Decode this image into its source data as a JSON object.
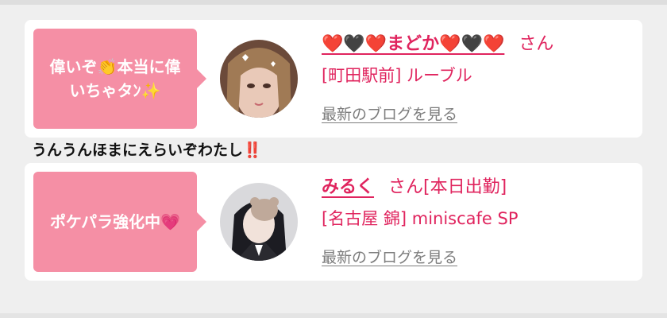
{
  "colors": {
    "accent": "#e0245e",
    "bubble": "#f58fa5",
    "link_gray": "#7d7d7d",
    "background": "#efefef"
  },
  "posts": [
    {
      "bubble_lines": [
        "偉いぞ👏本当に偉",
        "いちゃタﾝ✨"
      ],
      "name": "❤️🖤❤️まどか❤️🖤❤️",
      "honorific": "さん",
      "status": "",
      "shop": "[町田駅前] ルーブル",
      "blog_link": "最新のブログを見る"
    },
    {
      "bubble_lines": [
        "ポケパラ強化中💗"
      ],
      "name": "みるく",
      "honorific": "さん",
      "status": "[本日出勤]",
      "shop": "[名古屋 錦] miniscafe SP",
      "blog_link": "最新のブログを見る"
    }
  ],
  "comment": {
    "text": "うんうんほまにえらいぞわたし",
    "emphasis": "‼️"
  }
}
